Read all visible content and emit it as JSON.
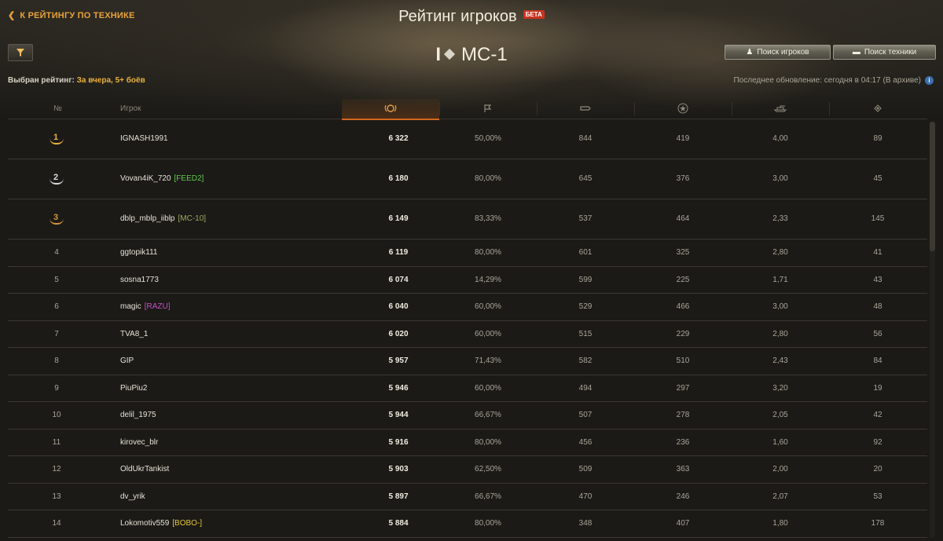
{
  "header": {
    "back_label": "К РЕЙТИНГУ ПО ТЕХНИКЕ",
    "title": "Рейтинг игроков",
    "beta_badge": "БЕТА",
    "tank_tier": "I",
    "tank_name": "МС-1",
    "search_players": "Поиск игроков",
    "search_tech": "Поиск техники",
    "rating_label": "Выбран рейтинг:",
    "rating_value": "За вчера, 5+ боёв",
    "last_update": "Последнее обновление: сегодня в 04:17 (В архиве)"
  },
  "columns": {
    "num": "№",
    "player": "Игрок",
    "icons": [
      "laurel-icon",
      "flag-icon",
      "damage-icon",
      "star-icon",
      "tank-icon",
      "target-icon"
    ]
  },
  "colors": {
    "accent": "#e8a33a",
    "sort_underline": "#d3661f",
    "gold": "#e8b23c",
    "silver": "#d9d9d9",
    "bronze": "#d6953a"
  },
  "rows": [
    {
      "rank": "1",
      "name": "IGNASH1991",
      "clan": "",
      "clan_color": "",
      "rating": "6 322",
      "winrate": "50,00%",
      "damage": "844",
      "exp": "419",
      "kills": "4,00",
      "spot": "89"
    },
    {
      "rank": "2",
      "name": "Vovan4iK_720",
      "clan": "[FEED2]",
      "clan_color": "#5fcb4e",
      "rating": "6 180",
      "winrate": "80,00%",
      "damage": "645",
      "exp": "376",
      "kills": "3,00",
      "spot": "45"
    },
    {
      "rank": "3",
      "name": "dblp_mblp_iiblp",
      "clan": "[MC-10]",
      "clan_color": "#9fa85a",
      "rating": "6 149",
      "winrate": "83,33%",
      "damage": "537",
      "exp": "464",
      "kills": "2,33",
      "spot": "145"
    },
    {
      "rank": "4",
      "name": "ggtopik111",
      "clan": "",
      "clan_color": "",
      "rating": "6 119",
      "winrate": "80,00%",
      "damage": "601",
      "exp": "325",
      "kills": "2,80",
      "spot": "41"
    },
    {
      "rank": "5",
      "name": "sosna1773",
      "clan": "",
      "clan_color": "",
      "rating": "6 074",
      "winrate": "14,29%",
      "damage": "599",
      "exp": "225",
      "kills": "1,71",
      "spot": "43"
    },
    {
      "rank": "6",
      "name": "magic",
      "clan": "[RAZU]",
      "clan_color": "#c64fc6",
      "rating": "6 040",
      "winrate": "60,00%",
      "damage": "529",
      "exp": "466",
      "kills": "3,00",
      "spot": "48"
    },
    {
      "rank": "7",
      "name": "TVA8_1",
      "clan": "",
      "clan_color": "",
      "rating": "6 020",
      "winrate": "60,00%",
      "damage": "515",
      "exp": "229",
      "kills": "2,80",
      "spot": "56"
    },
    {
      "rank": "8",
      "name": "GIP",
      "clan": "",
      "clan_color": "",
      "rating": "5 957",
      "winrate": "71,43%",
      "damage": "582",
      "exp": "510",
      "kills": "2,43",
      "spot": "84"
    },
    {
      "rank": "9",
      "name": "PiuPiu2",
      "clan": "",
      "clan_color": "",
      "rating": "5 946",
      "winrate": "60,00%",
      "damage": "494",
      "exp": "297",
      "kills": "3,20",
      "spot": "19"
    },
    {
      "rank": "10",
      "name": "delil_1975",
      "clan": "",
      "clan_color": "",
      "rating": "5 944",
      "winrate": "66,67%",
      "damage": "507",
      "exp": "278",
      "kills": "2,05",
      "spot": "42"
    },
    {
      "rank": "11",
      "name": "kirovec_blr",
      "clan": "",
      "clan_color": "",
      "rating": "5 916",
      "winrate": "80,00%",
      "damage": "456",
      "exp": "236",
      "kills": "1,60",
      "spot": "92"
    },
    {
      "rank": "12",
      "name": "OldUkrTankist",
      "clan": "",
      "clan_color": "",
      "rating": "5 903",
      "winrate": "62,50%",
      "damage": "509",
      "exp": "363",
      "kills": "2,00",
      "spot": "20"
    },
    {
      "rank": "13",
      "name": "dv_yrik",
      "clan": "",
      "clan_color": "",
      "rating": "5 897",
      "winrate": "66,67%",
      "damage": "470",
      "exp": "246",
      "kills": "2,07",
      "spot": "53"
    },
    {
      "rank": "14",
      "name": "Lokomotiv559",
      "clan": "[BOBO-]",
      "clan_color": "#e3c736",
      "rating": "5 884",
      "winrate": "80,00%",
      "damage": "348",
      "exp": "407",
      "kills": "1,80",
      "spot": "178"
    }
  ]
}
